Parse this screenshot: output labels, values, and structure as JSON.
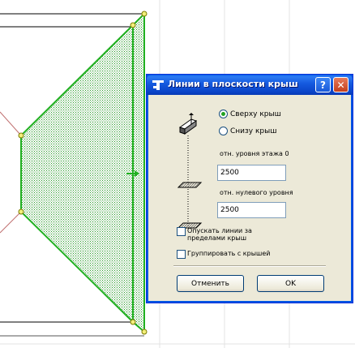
{
  "dialog": {
    "title": "Линии в плоскости крыш",
    "help_label": "?",
    "close_label": "✕",
    "radio_top_label": "Сверху крыш",
    "radio_bottom_label": "Снизу крыш",
    "radio_selected": "top",
    "level_story_label": "отн. уровня этажа 0",
    "level_story_value": "2500",
    "level_zero_label": "отн. нулевого уровня",
    "level_zero_value": "2500",
    "checkbox_lower_label_line1": "Опускать линии за",
    "checkbox_lower_label_line2": "пределами крыш",
    "checkbox_lower_checked": false,
    "checkbox_group_label": "Группировать с крышей",
    "checkbox_group_checked": false,
    "cancel_label": "Отменить",
    "ok_label": "OK"
  },
  "colors": {
    "selection_green": "#20b020",
    "hatch_green": "#2a9a2a",
    "grid_gray": "#e3e3e3",
    "roof_outline_red": "#c07070",
    "titlebar_blue": "#0a44c8"
  }
}
